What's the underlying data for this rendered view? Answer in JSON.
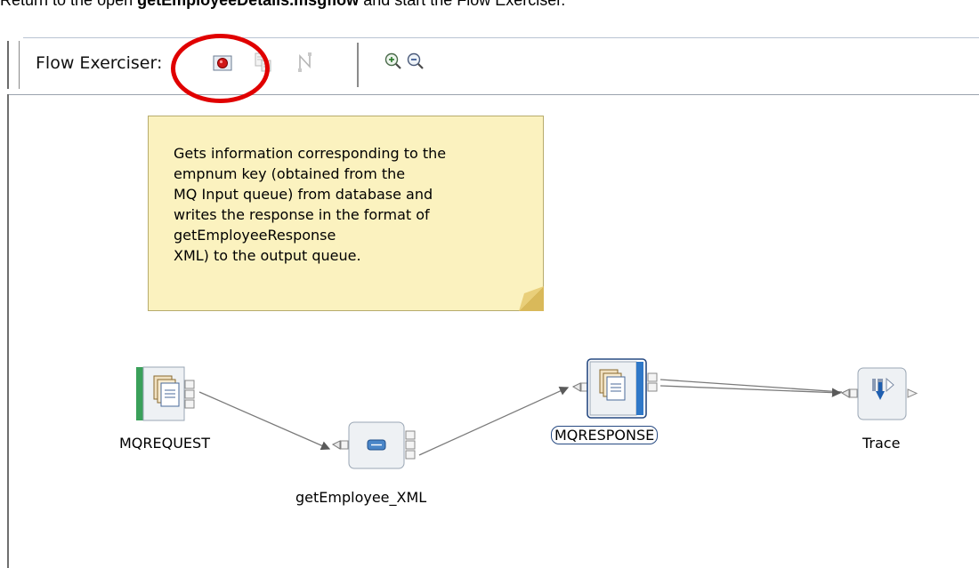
{
  "instruction": {
    "prefix": "Return to the open ",
    "bold": "getEmployeeDetails.msgflow",
    "suffix": " and start the Flow Exerciser."
  },
  "toolbar": {
    "flow_exerciser_label": "Flow Exerciser:",
    "buttons": [
      {
        "name": "start-flow-exerciser",
        "icon": "record-icon",
        "enabled": true
      },
      {
        "name": "send-message",
        "icon": "message-icon",
        "enabled": false
      },
      {
        "name": "view-path",
        "icon": "path-icon",
        "enabled": false
      },
      {
        "name": "zoom-in",
        "icon": "zoom-in-icon",
        "enabled": true
      },
      {
        "name": "zoom-out",
        "icon": "zoom-out-icon",
        "enabled": true
      }
    ]
  },
  "note": {
    "text": "Gets information corresponding to the\nempnum key (obtained from the\nMQ Input queue) from database and\nwrites the response in the format of\ngetEmployeeResponse\nXML) to the output queue."
  },
  "nodes": {
    "mqrequest": {
      "label": "MQREQUEST",
      "icon": "mq-input-icon"
    },
    "getemployee": {
      "label": "getEmployee_XML",
      "icon": "compute-icon"
    },
    "mqresponse": {
      "label": "MQRESPONSE",
      "icon": "mq-output-icon",
      "selected": true
    },
    "trace": {
      "label": "Trace",
      "icon": "trace-icon"
    }
  },
  "colors": {
    "highlight_circle": "#e00000",
    "note_background": "#fbf2bf",
    "node_background": "#eef1f4",
    "selection_blue": "#274a82",
    "input_bar_green": "#3aa05a",
    "output_bar_blue": "#2f78c8"
  }
}
